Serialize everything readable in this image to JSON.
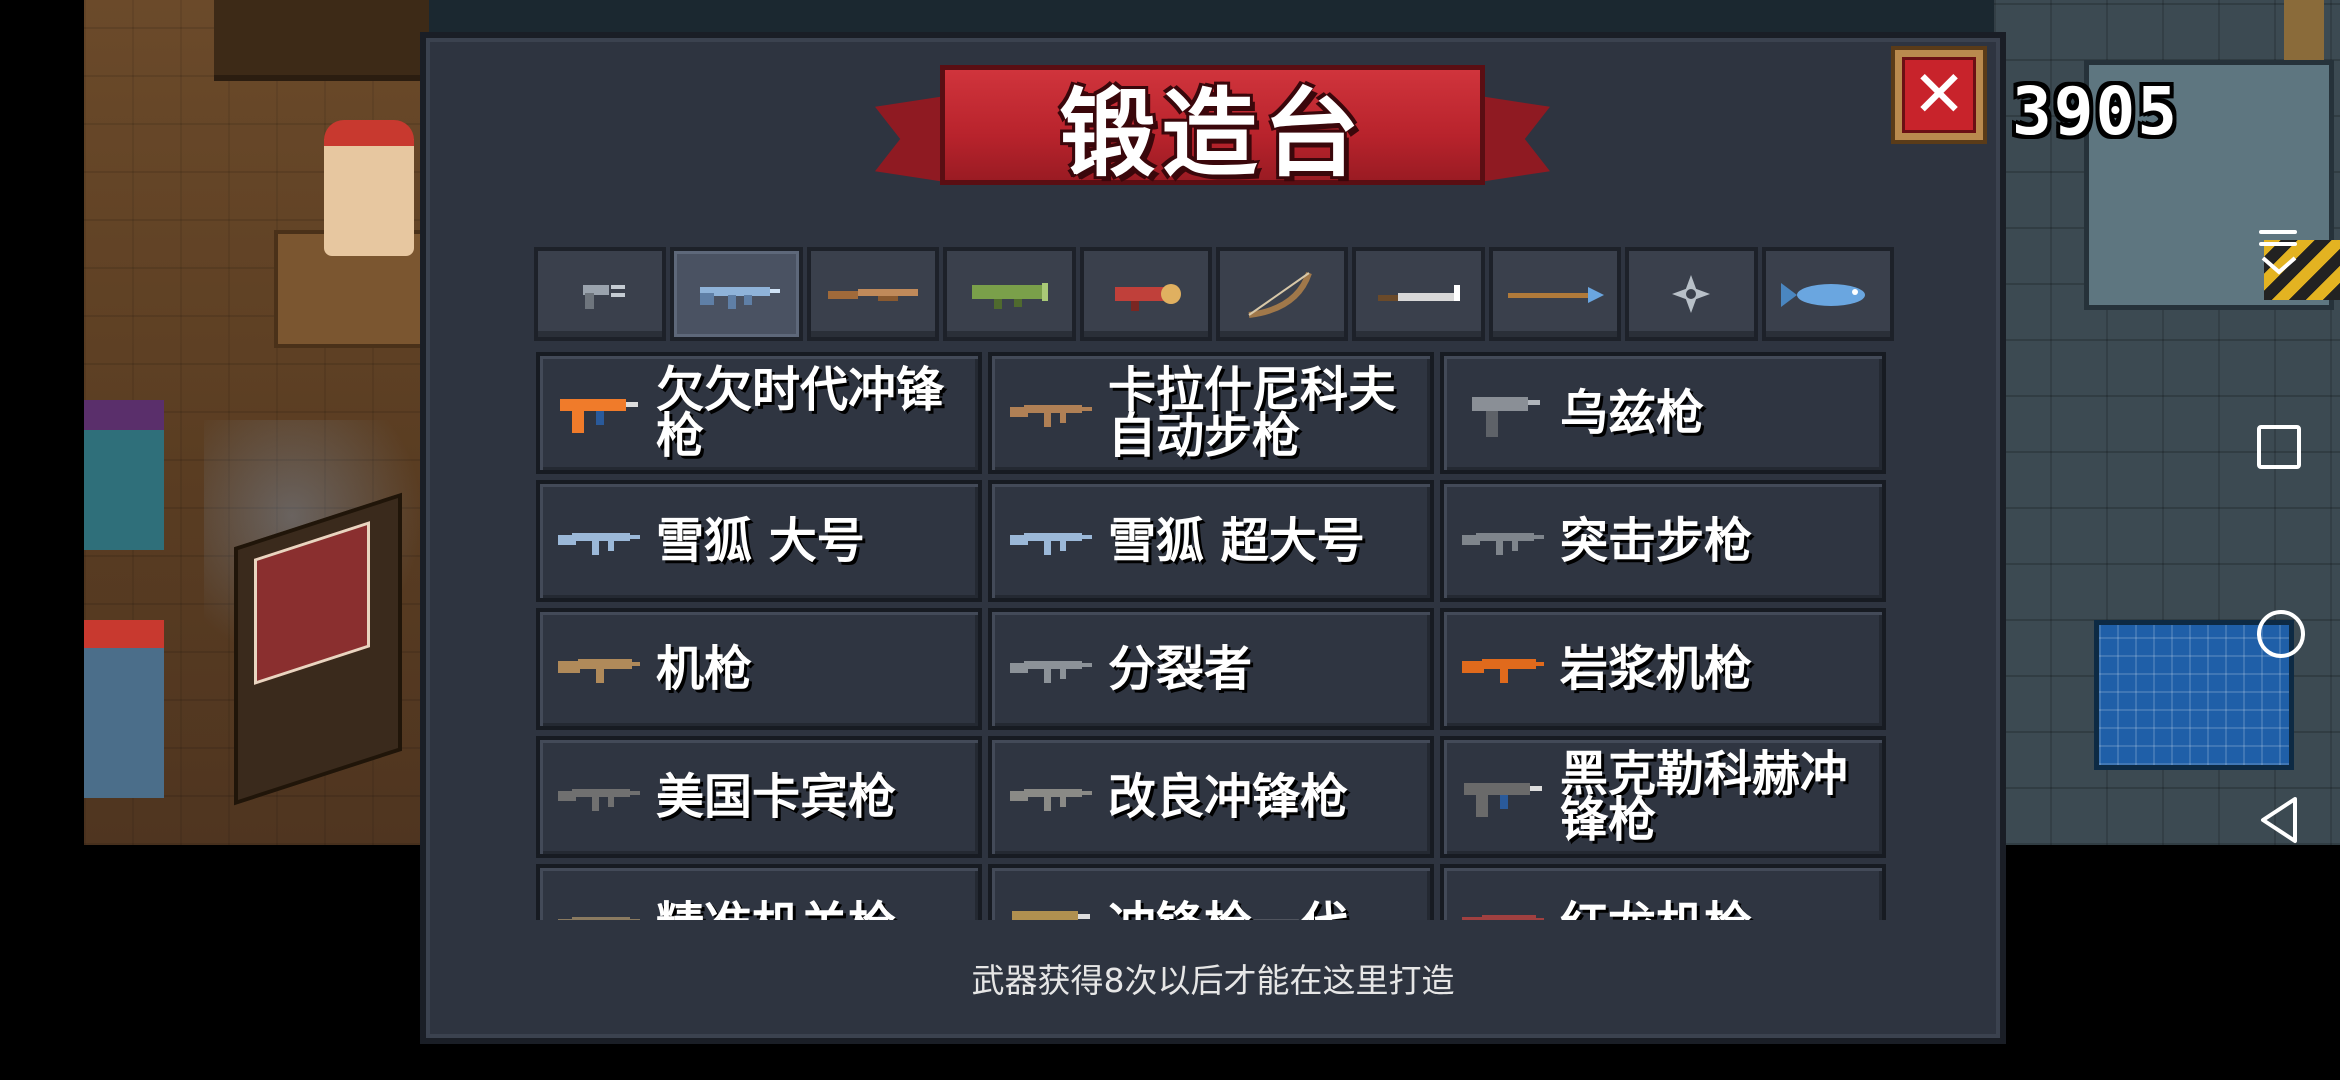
{
  "game": {
    "coins": "3905"
  },
  "forge": {
    "title": "锻造台",
    "close_label": "✕",
    "footer_note": "武器获得8次以后才能在这里打造",
    "tabs": [
      {
        "name": "pistol-icon",
        "color": "#9aa3ad"
      },
      {
        "name": "rifle-icon",
        "color": "#8fb3d9"
      },
      {
        "name": "shotgun-icon",
        "color": "#c08a5a"
      },
      {
        "name": "launcher-icon",
        "color": "#7aa04a"
      },
      {
        "name": "rocket-icon",
        "color": "#c0403a"
      },
      {
        "name": "bow-icon",
        "color": "#a0784a"
      },
      {
        "name": "sword-icon",
        "color": "#d8d8d8"
      },
      {
        "name": "spear-icon",
        "color": "#b07a3a"
      },
      {
        "name": "shuriken-icon",
        "color": "#b8c0c8"
      },
      {
        "name": "fish-icon",
        "color": "#6aa6e0"
      }
    ],
    "weapons": [
      {
        "name": "欠欠时代冲锋枪",
        "icon": "smg-icon",
        "color": "#f07b2a"
      },
      {
        "name": "卡拉什尼科夫自动步枪",
        "icon": "rifle-icon",
        "color": "#b08055"
      },
      {
        "name": "乌兹枪",
        "icon": "uzi-icon",
        "color": "#8a8f96"
      },
      {
        "name": "雪狐 大号",
        "icon": "rifle-icon",
        "color": "#9bb8d8"
      },
      {
        "name": "雪狐 超大号",
        "icon": "rifle-icon",
        "color": "#9bb8d8"
      },
      {
        "name": "突击步枪",
        "icon": "rifle-icon",
        "color": "#7f858c"
      },
      {
        "name": "机枪",
        "icon": "machinegun-icon",
        "color": "#b08a5a"
      },
      {
        "name": "分裂者",
        "icon": "rifle-icon",
        "color": "#8c9298"
      },
      {
        "name": "岩浆机枪",
        "icon": "machinegun-icon",
        "color": "#e06a1c"
      },
      {
        "name": "美国卡宾枪",
        "icon": "rifle-icon",
        "color": "#707070"
      },
      {
        "name": "改良冲锋枪",
        "icon": "rifle-icon",
        "color": "#8a8a86"
      },
      {
        "name": "黑克勒科赫冲锋枪",
        "icon": "smg-icon",
        "color": "#6a6a6a"
      },
      {
        "name": "精准机关枪",
        "icon": "rifle-icon",
        "color": "#8a7a60"
      },
      {
        "name": "冲锋枪一代",
        "icon": "smg-icon",
        "color": "#b09050"
      },
      {
        "name": "红龙机枪",
        "icon": "machinegun-icon",
        "color": "#a04040"
      }
    ]
  }
}
